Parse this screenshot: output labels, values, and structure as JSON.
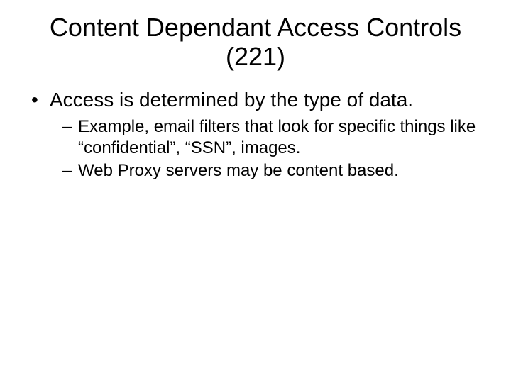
{
  "title": "Content Dependant Access Controls (221)",
  "bullets": [
    {
      "text": "Access is determined by the type of data.",
      "sub": [
        "Example, email filters that look for specific things like “confidential”, “SSN”, images.",
        "Web Proxy servers may be content based."
      ]
    }
  ]
}
